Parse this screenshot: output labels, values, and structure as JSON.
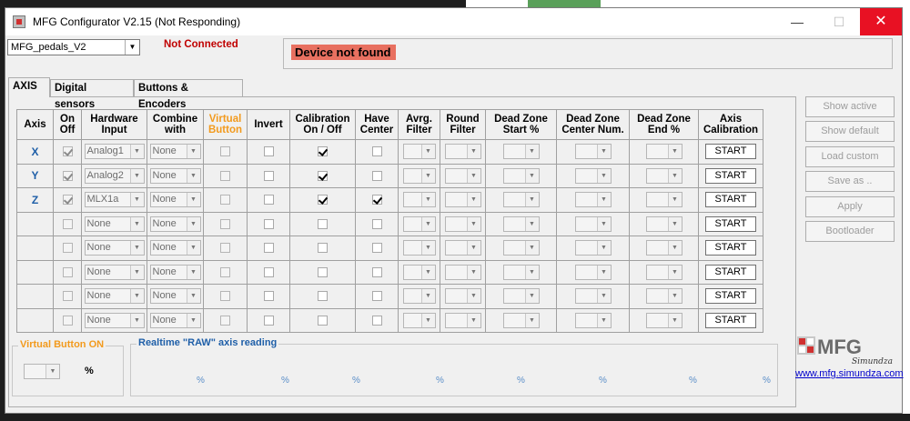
{
  "window": {
    "title": "MFG Configurator V2.15 (Not Responding)",
    "minimize_label": "—",
    "maximize_label": "☐",
    "close_label": "✕"
  },
  "profile": {
    "selected": "MFG_pedals_V2"
  },
  "connection": {
    "status": "Not Connected",
    "device_message": "Device not found"
  },
  "tabs": [
    {
      "label": "AXIS"
    },
    {
      "label": "Digital sensors"
    },
    {
      "label": "Buttons & Encoders"
    }
  ],
  "table": {
    "headers": {
      "axis": "Axis",
      "on_off": "On Off",
      "hardware_input": "Hardware Input",
      "combine_with": "Combine with",
      "virtual_button": "Virtual Button",
      "invert": "Invert",
      "calibration": "Calibration On / Off",
      "have_center": "Have Center",
      "avrg_filter": "Avrg. Filter",
      "round_filter": "Round Filter",
      "dz_start": "Dead Zone Start %",
      "dz_center": "Dead Zone Center Num.",
      "dz_end": "Dead Zone End %",
      "axis_calibration": "Axis Calibration"
    },
    "rows": [
      {
        "axis": "X",
        "on": true,
        "hw": "Analog1",
        "combine": "None",
        "vbtn": false,
        "invert": false,
        "calib": true,
        "center": false,
        "start": "START"
      },
      {
        "axis": "Y",
        "on": true,
        "hw": "Analog2",
        "combine": "None",
        "vbtn": false,
        "invert": false,
        "calib": true,
        "center": false,
        "start": "START"
      },
      {
        "axis": "Z",
        "on": true,
        "hw": "MLX1a",
        "combine": "None",
        "vbtn": false,
        "invert": false,
        "calib": true,
        "center": true,
        "start": "START"
      },
      {
        "axis": "",
        "on": false,
        "hw": "None",
        "combine": "None",
        "vbtn": false,
        "invert": false,
        "calib": false,
        "center": false,
        "start": "START"
      },
      {
        "axis": "",
        "on": false,
        "hw": "None",
        "combine": "None",
        "vbtn": false,
        "invert": false,
        "calib": false,
        "center": false,
        "start": "START"
      },
      {
        "axis": "",
        "on": false,
        "hw": "None",
        "combine": "None",
        "vbtn": false,
        "invert": false,
        "calib": false,
        "center": false,
        "start": "START"
      },
      {
        "axis": "",
        "on": false,
        "hw": "None",
        "combine": "None",
        "vbtn": false,
        "invert": false,
        "calib": false,
        "center": false,
        "start": "START"
      },
      {
        "axis": "",
        "on": false,
        "hw": "None",
        "combine": "None",
        "vbtn": false,
        "invert": false,
        "calib": false,
        "center": false,
        "start": "START"
      }
    ]
  },
  "side_buttons": [
    {
      "label": "Show active"
    },
    {
      "label": "Show default"
    },
    {
      "label": "Load custom"
    },
    {
      "label": "Save as .."
    },
    {
      "label": "Apply"
    },
    {
      "label": "Bootloader"
    }
  ],
  "virtual_button_group": {
    "title": "Virtual Button ON",
    "unit": "%"
  },
  "realtime_group": {
    "title": "Realtime \"RAW\" axis reading",
    "unit": "%"
  },
  "logo": {
    "text": "MFG",
    "script": "Simundza"
  },
  "website": "www.mfg.simundza.com",
  "colors": {
    "accent_orange": "#f29a1d",
    "axis_blue": "#1f5fa8",
    "error_red": "#c00000",
    "close_red": "#e81123"
  }
}
